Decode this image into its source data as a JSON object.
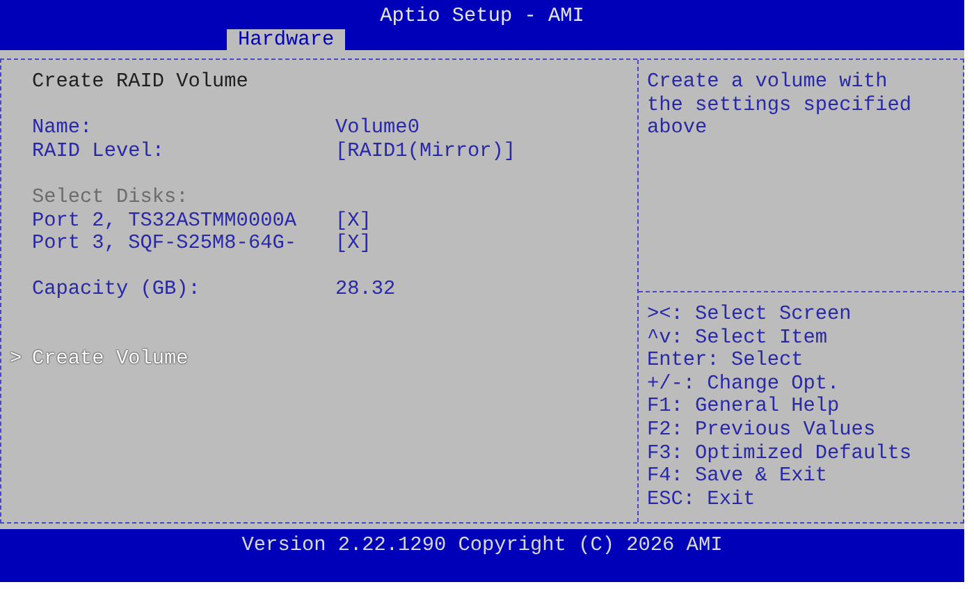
{
  "title": "Aptio Setup - AMI",
  "tabs": [
    {
      "label": "Hardware",
      "selected": true
    }
  ],
  "form": {
    "heading": "Create RAID Volume",
    "groups": [
      [
        {
          "kind": "field",
          "label": "Name:",
          "value": "Volume0",
          "selected": false
        },
        {
          "kind": "field",
          "label": "RAID Level:",
          "value": "[RAID1(Mirror)]",
          "selected": false
        }
      ],
      [
        {
          "kind": "subheading",
          "label": "Select Disks:",
          "selected": false
        },
        {
          "kind": "field",
          "label": "Port 2, TS32ASTMM0000A",
          "value": "[X]",
          "selected": false
        },
        {
          "kind": "field",
          "label": "Port 3, SQF-S25M8-64G-",
          "value": "[X]",
          "selected": false
        }
      ],
      [
        {
          "kind": "field",
          "label": "Capacity (GB):",
          "value": "28.32",
          "selected": false
        }
      ],
      [
        {
          "kind": "action",
          "marker": ">",
          "label": "Create Volume",
          "selected": true
        }
      ]
    ]
  },
  "help": {
    "lines": [
      "Create a volume with",
      "the settings specified",
      "above"
    ]
  },
  "keys": [
    "><: Select Screen",
    "^v: Select Item",
    "Enter: Select",
    "+/-: Change Opt.",
    "F1: General Help",
    "F2: Previous Values",
    "F3: Optimized Defaults",
    "F4: Save & Exit",
    "ESC: Exit"
  ],
  "footer": "Version 2.22.1290 Copyright (C) 2026 AMI"
}
